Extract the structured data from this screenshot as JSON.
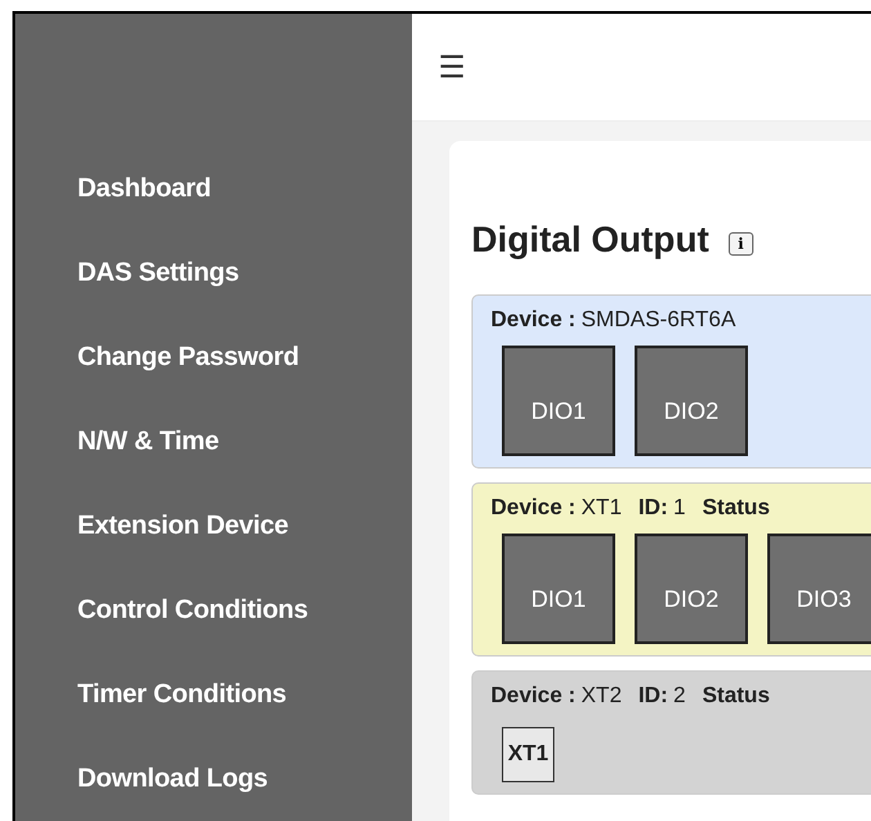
{
  "sidebar": {
    "items": [
      {
        "label": "Dashboard"
      },
      {
        "label": "DAS Settings"
      },
      {
        "label": "Change Password"
      },
      {
        "label": "N/W & Time"
      },
      {
        "label": "Extension Device"
      },
      {
        "label": "Control Conditions"
      },
      {
        "label": "Timer Conditions"
      },
      {
        "label": "Download Logs"
      }
    ]
  },
  "header": {
    "menu_icon": "☰"
  },
  "page": {
    "title": "Digital Output",
    "info_button": "i"
  },
  "devices": [
    {
      "device_label": "Device :",
      "device": "SMDAS-6RT6A",
      "color": "#dce8fb",
      "buttons": [
        {
          "kind": "output",
          "label": "DIO1"
        },
        {
          "kind": "output",
          "label": "DIO2"
        }
      ]
    },
    {
      "device_label": "Device :",
      "device": "XT1",
      "id_label": "ID:",
      "id": "1",
      "status_label": "Status",
      "color": "#f4f4c4",
      "buttons": [
        {
          "kind": "output",
          "label": "DIO1"
        },
        {
          "kind": "output",
          "label": "DIO2"
        },
        {
          "kind": "output",
          "label": "DIO3"
        }
      ]
    },
    {
      "device_label": "Device :",
      "device": "XT2",
      "id_label": "ID:",
      "id": "2",
      "status_label": "Status",
      "color": "#d3d3d3",
      "buttons": [
        {
          "kind": "tag",
          "label": "XT1"
        }
      ]
    }
  ]
}
